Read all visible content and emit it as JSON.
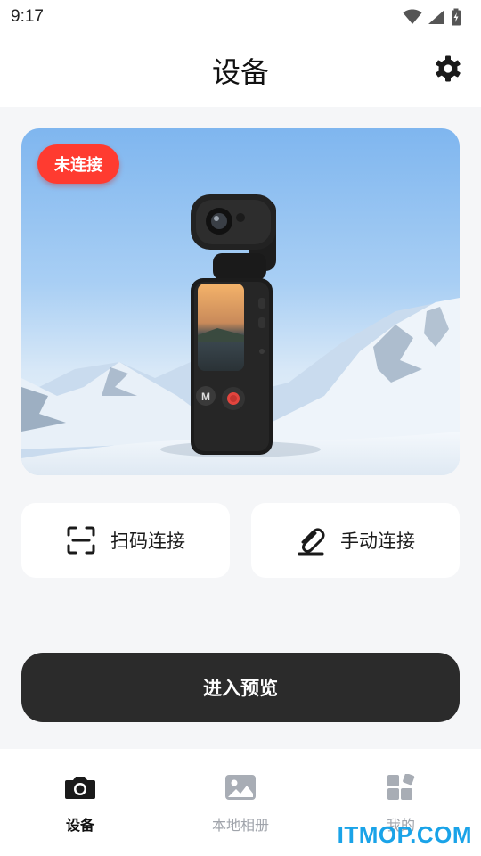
{
  "status_bar": {
    "time": "9:17",
    "icons": [
      "wifi-icon",
      "signal-icon",
      "battery-icon"
    ]
  },
  "header": {
    "title": "设备",
    "settings_icon": "gear-icon"
  },
  "device_card": {
    "status_badge": "未连接",
    "badge_color": "#ff3b30"
  },
  "connect_options": [
    {
      "label": "扫码连接",
      "icon": "scan-icon"
    },
    {
      "label": "手动连接",
      "icon": "link-icon"
    }
  ],
  "preview_button": {
    "label": "进入预览",
    "color": "#2b2b2b"
  },
  "tabs": [
    {
      "label": "设备",
      "icon": "camera-icon",
      "active": true
    },
    {
      "label": "本地相册",
      "icon": "gallery-icon",
      "active": false
    },
    {
      "label": "我的",
      "icon": "grid-icon",
      "active": false
    }
  ],
  "watermark": "ITMOP.COM"
}
